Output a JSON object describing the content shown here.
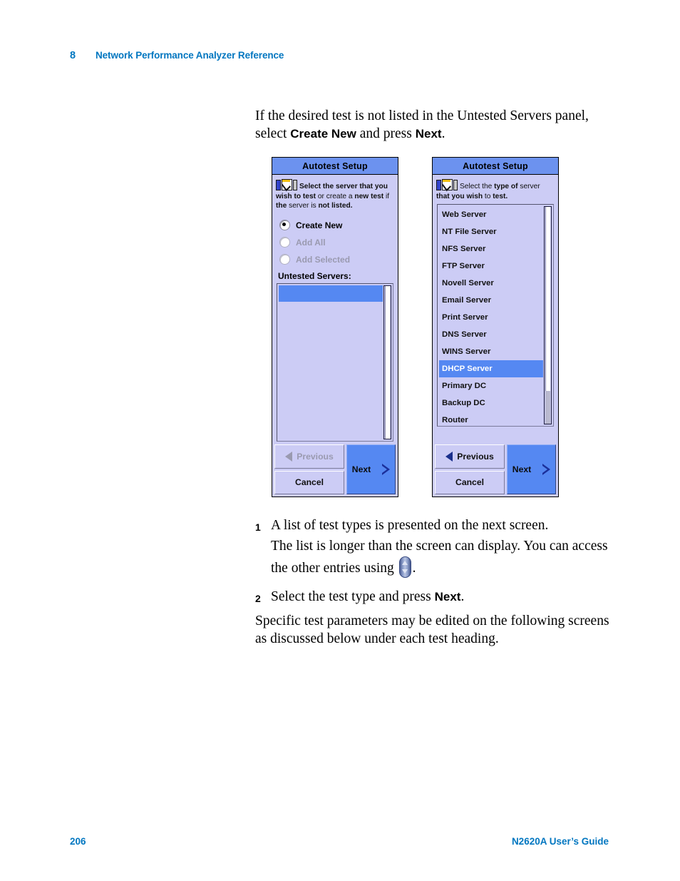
{
  "header": {
    "chapter_number": "8",
    "chapter_title": "Network Performance Analyzer Reference"
  },
  "intro": {
    "line1": "If the desired test is not listed in the Untested Servers panel,",
    "line2_pre": "select ",
    "line2_bold1": "Create New",
    "line2_mid": " and press ",
    "line2_bold2": "Next",
    "line2_end": "."
  },
  "figure": {
    "left_screen": {
      "title": "Autotest Setup",
      "icon": "wizard-icon",
      "prompt_bold1": "Select the server that you",
      "prompt_line2_a": "wish to test",
      "prompt_line2_b": " or create a ",
      "prompt_line2_c": "new test",
      "prompt_line2_d": " if",
      "prompt_line3_a": "the",
      "prompt_line3_b": " server is ",
      "prompt_line3_c": "not listed",
      "prompt_line3_d": ".",
      "radios": [
        {
          "label": "Create New",
          "selected": true,
          "disabled": false
        },
        {
          "label": "Add All",
          "selected": false,
          "disabled": true
        },
        {
          "label": "Add Selected",
          "selected": false,
          "disabled": true
        }
      ],
      "list_label": "Untested Servers:",
      "list_items": [],
      "selected_blank_row": true,
      "scrollbar": {
        "thumb_percent": 100
      },
      "buttons": {
        "previous": "Previous",
        "previous_disabled": true,
        "cancel": "Cancel",
        "next": "Next"
      }
    },
    "right_screen": {
      "title": "Autotest Setup",
      "icon": "wizard-icon",
      "prompt_line1_a": "Select the ",
      "prompt_line1_b": "type of",
      "prompt_line1_c": " server",
      "prompt_line2_a": "that you wish",
      "prompt_line2_b": " to ",
      "prompt_line2_c": "test",
      "prompt_line2_d": ".",
      "list_items": [
        "Web Server",
        "NT File Server",
        "NFS Server",
        "FTP Server",
        "Novell Server",
        "Email Server",
        "Print Server",
        "DNS Server",
        "WINS Server",
        "DHCP Server",
        "Primary DC",
        "Backup DC",
        "Router"
      ],
      "selected_item": "DHCP Server",
      "scrollbar": {
        "thumb_percent": 85
      },
      "buttons": {
        "previous": "Previous",
        "previous_disabled": false,
        "cancel": "Cancel",
        "next": "Next"
      }
    }
  },
  "steps": [
    {
      "number": "1",
      "line1": "A list of test types is presented on the next screen.",
      "line2": "The list is longer than the screen can display. You can access",
      "line3_pre": "the other entries using ",
      "line3_icon": "up-down-rocker-icon",
      "line3_post": "."
    },
    {
      "number": "2",
      "text_pre": "Select the test type and press ",
      "text_bold": "Next",
      "text_post": "."
    }
  ],
  "tail_paragraph": {
    "line1": "Specific test parameters may be edited on the following screens",
    "line2": "as discussed below under each test heading."
  },
  "footer": {
    "page_number": "206",
    "guide_title": "N2620A User’s Guide"
  },
  "colors": {
    "accent_blue": "#0076c0",
    "titlebar_blue": "#6c92ef",
    "panel_lavender": "#ccccf5",
    "selection_blue": "#5588f2"
  }
}
